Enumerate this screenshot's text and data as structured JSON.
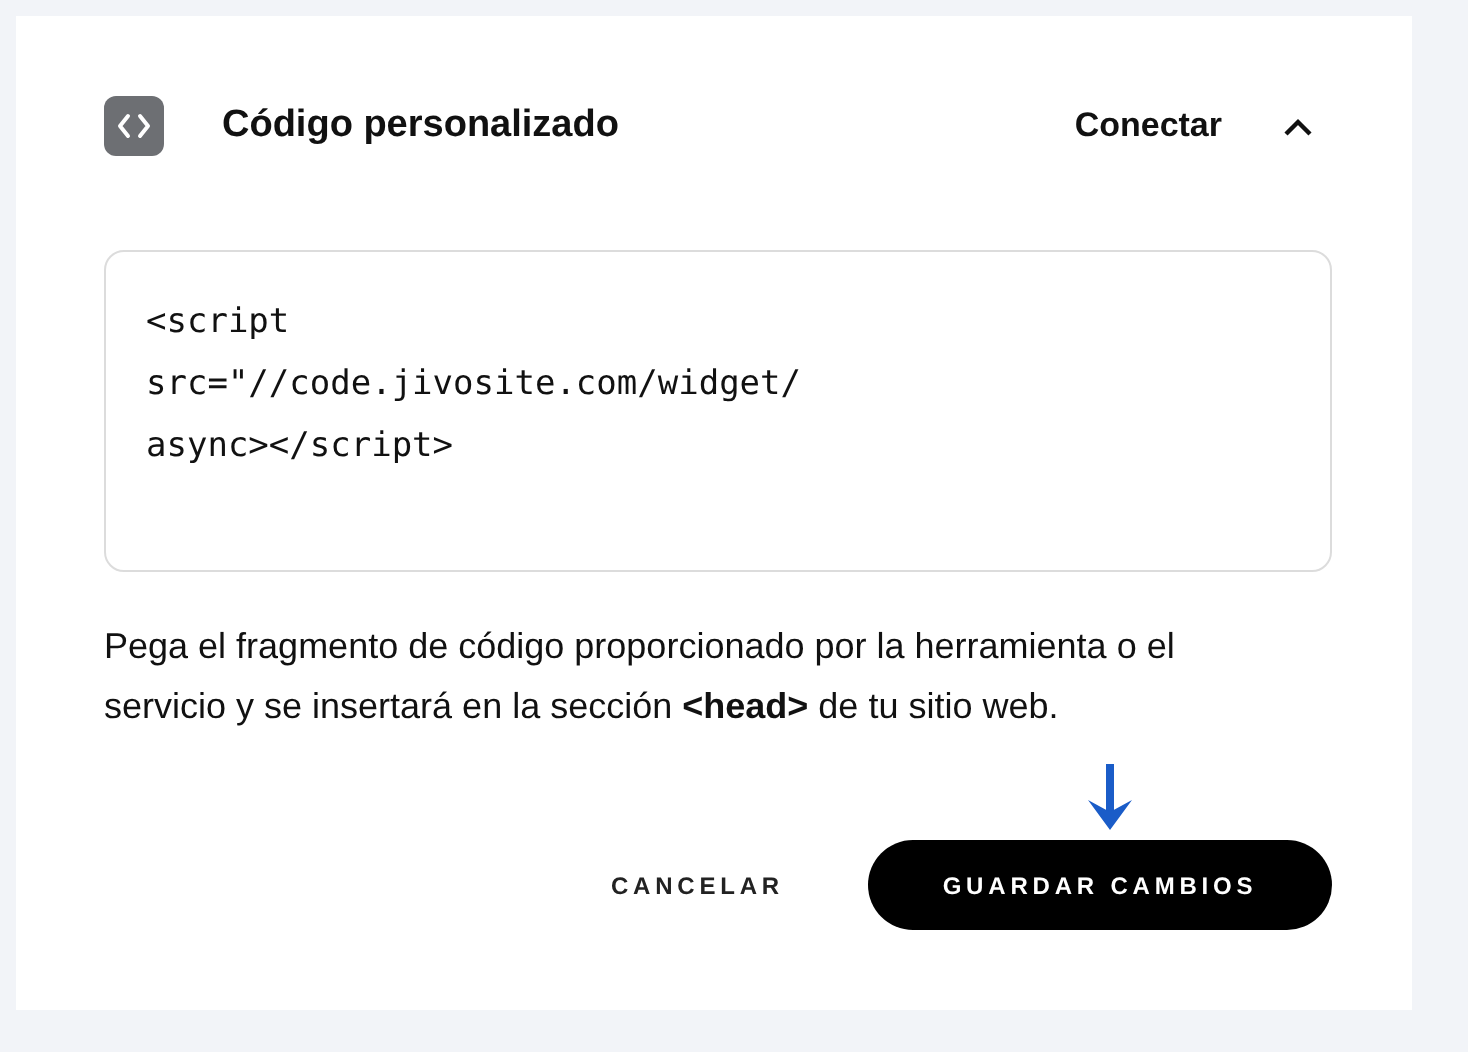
{
  "header": {
    "title": "Código personalizado",
    "action": "Conectar",
    "expanded": true
  },
  "code_field": {
    "lines": [
      "<script",
      "src=\"//code.jivosite.com/widget/",
      "async></script>"
    ]
  },
  "description": "Pega el fragmento de código proporcionado por la herramienta o el servicio y se insertará en la sección **<head>** de tu sitio web.",
  "buttons": [
    {
      "label": "CANCELAR",
      "kind": "text"
    },
    {
      "label": "GUARDAR CAMBIOS",
      "kind": "primary"
    }
  ]
}
